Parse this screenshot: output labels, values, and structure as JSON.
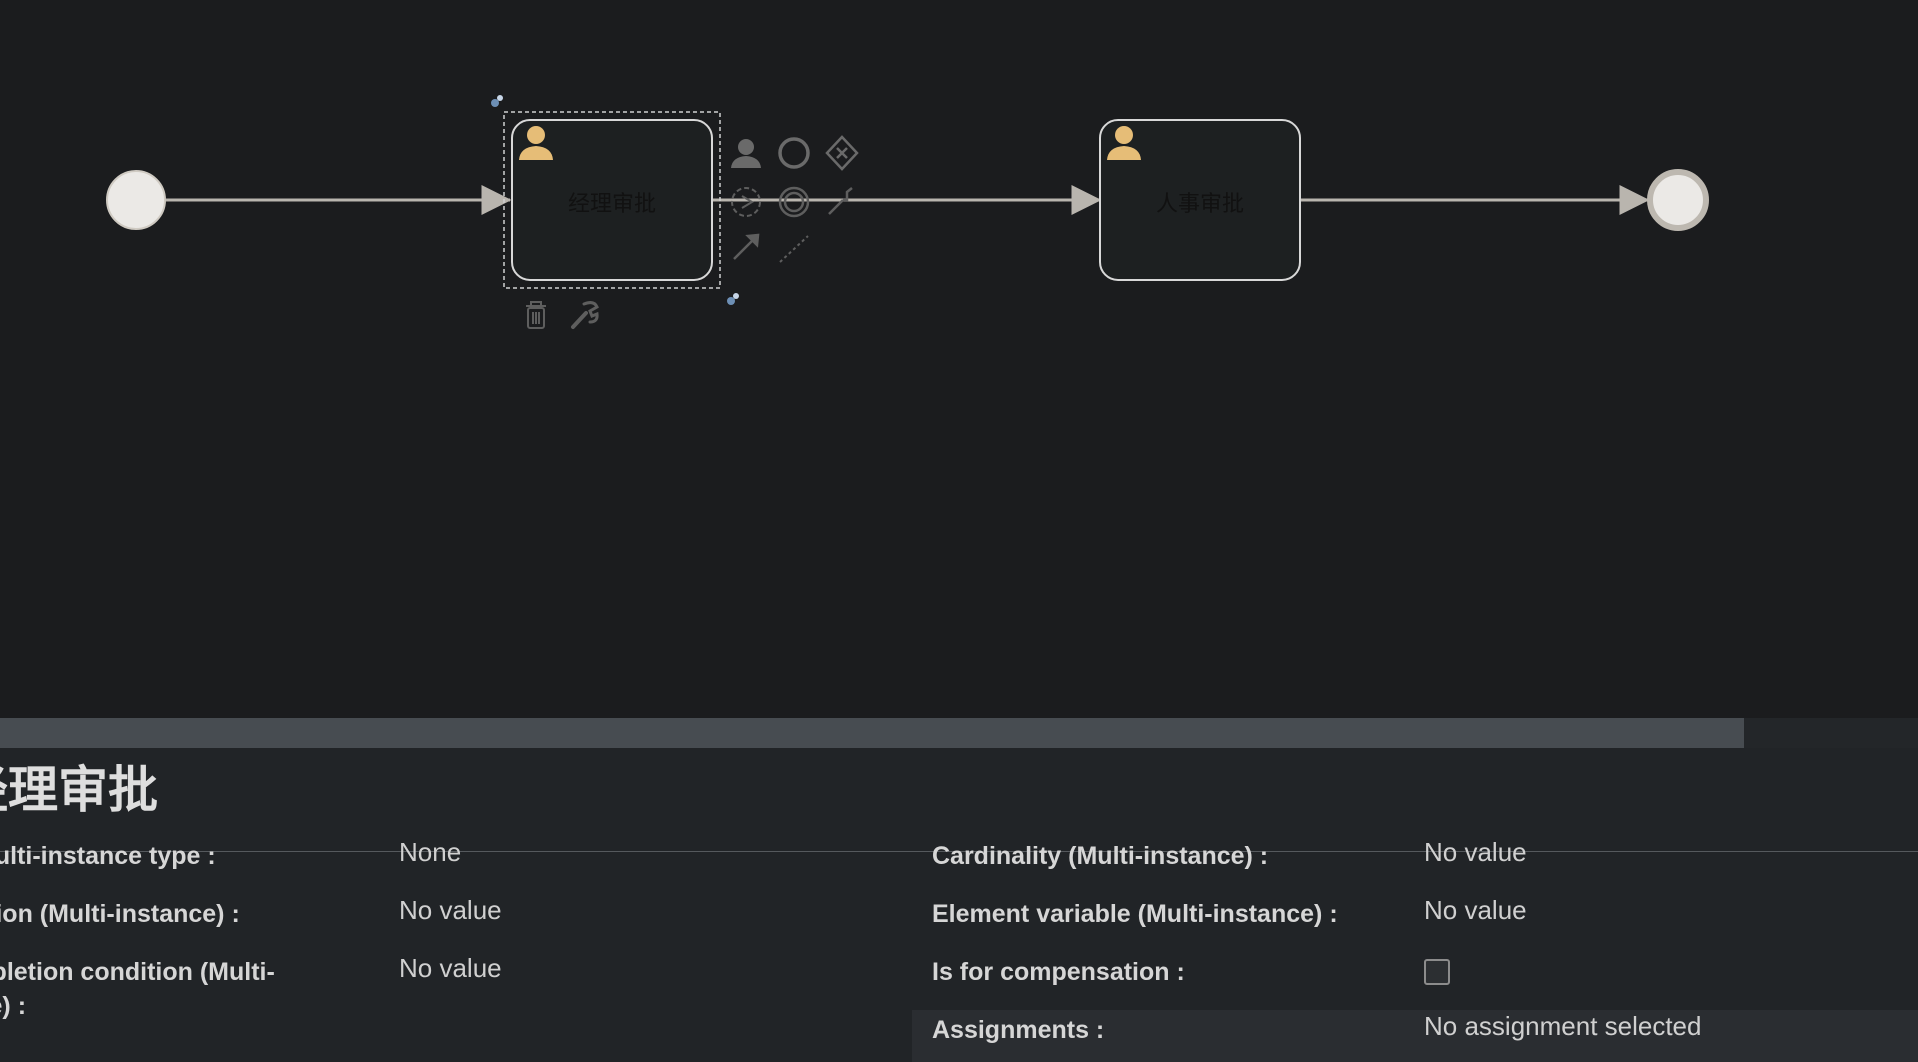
{
  "diagram": {
    "tasks": [
      {
        "id": "manager",
        "name": "经理审批"
      },
      {
        "id": "hr",
        "name": "人事审批"
      }
    ],
    "colors": {
      "canvas_bg": "#1b1c1e",
      "flow_line": "#b9b5ae",
      "event_fill": "#ebe9e6",
      "task_fill": "#1d2021",
      "task_stroke": "#d8d8d8",
      "user_icon": "#e6bd77"
    },
    "context_pad": {
      "icons": [
        "user-task-icon",
        "intermediate-event-icon",
        "gateway-icon",
        "start-event-icon",
        "end-event-icon",
        "text-annotation-icon",
        "connect-arrow-icon",
        "association-icon",
        "delete-icon",
        "wrench-icon"
      ]
    }
  },
  "properties": {
    "title": "经理审批",
    "left": [
      {
        "label": "Multi-instance type :",
        "value": "None"
      },
      {
        "label": "Collection (Multi-instance) :",
        "value": "No value"
      },
      {
        "label": "Completion condition (Multi-",
        "label2": "instance) :",
        "value": "No value"
      }
    ],
    "right": [
      {
        "label": "Cardinality (Multi-instance) :",
        "value": "No value"
      },
      {
        "label": "Element variable (Multi-instance) :",
        "value": "No value"
      },
      {
        "label": "Is for compensation :",
        "checkbox": false
      },
      {
        "label": "Assignments :",
        "value": "No assignment selected"
      }
    ]
  }
}
